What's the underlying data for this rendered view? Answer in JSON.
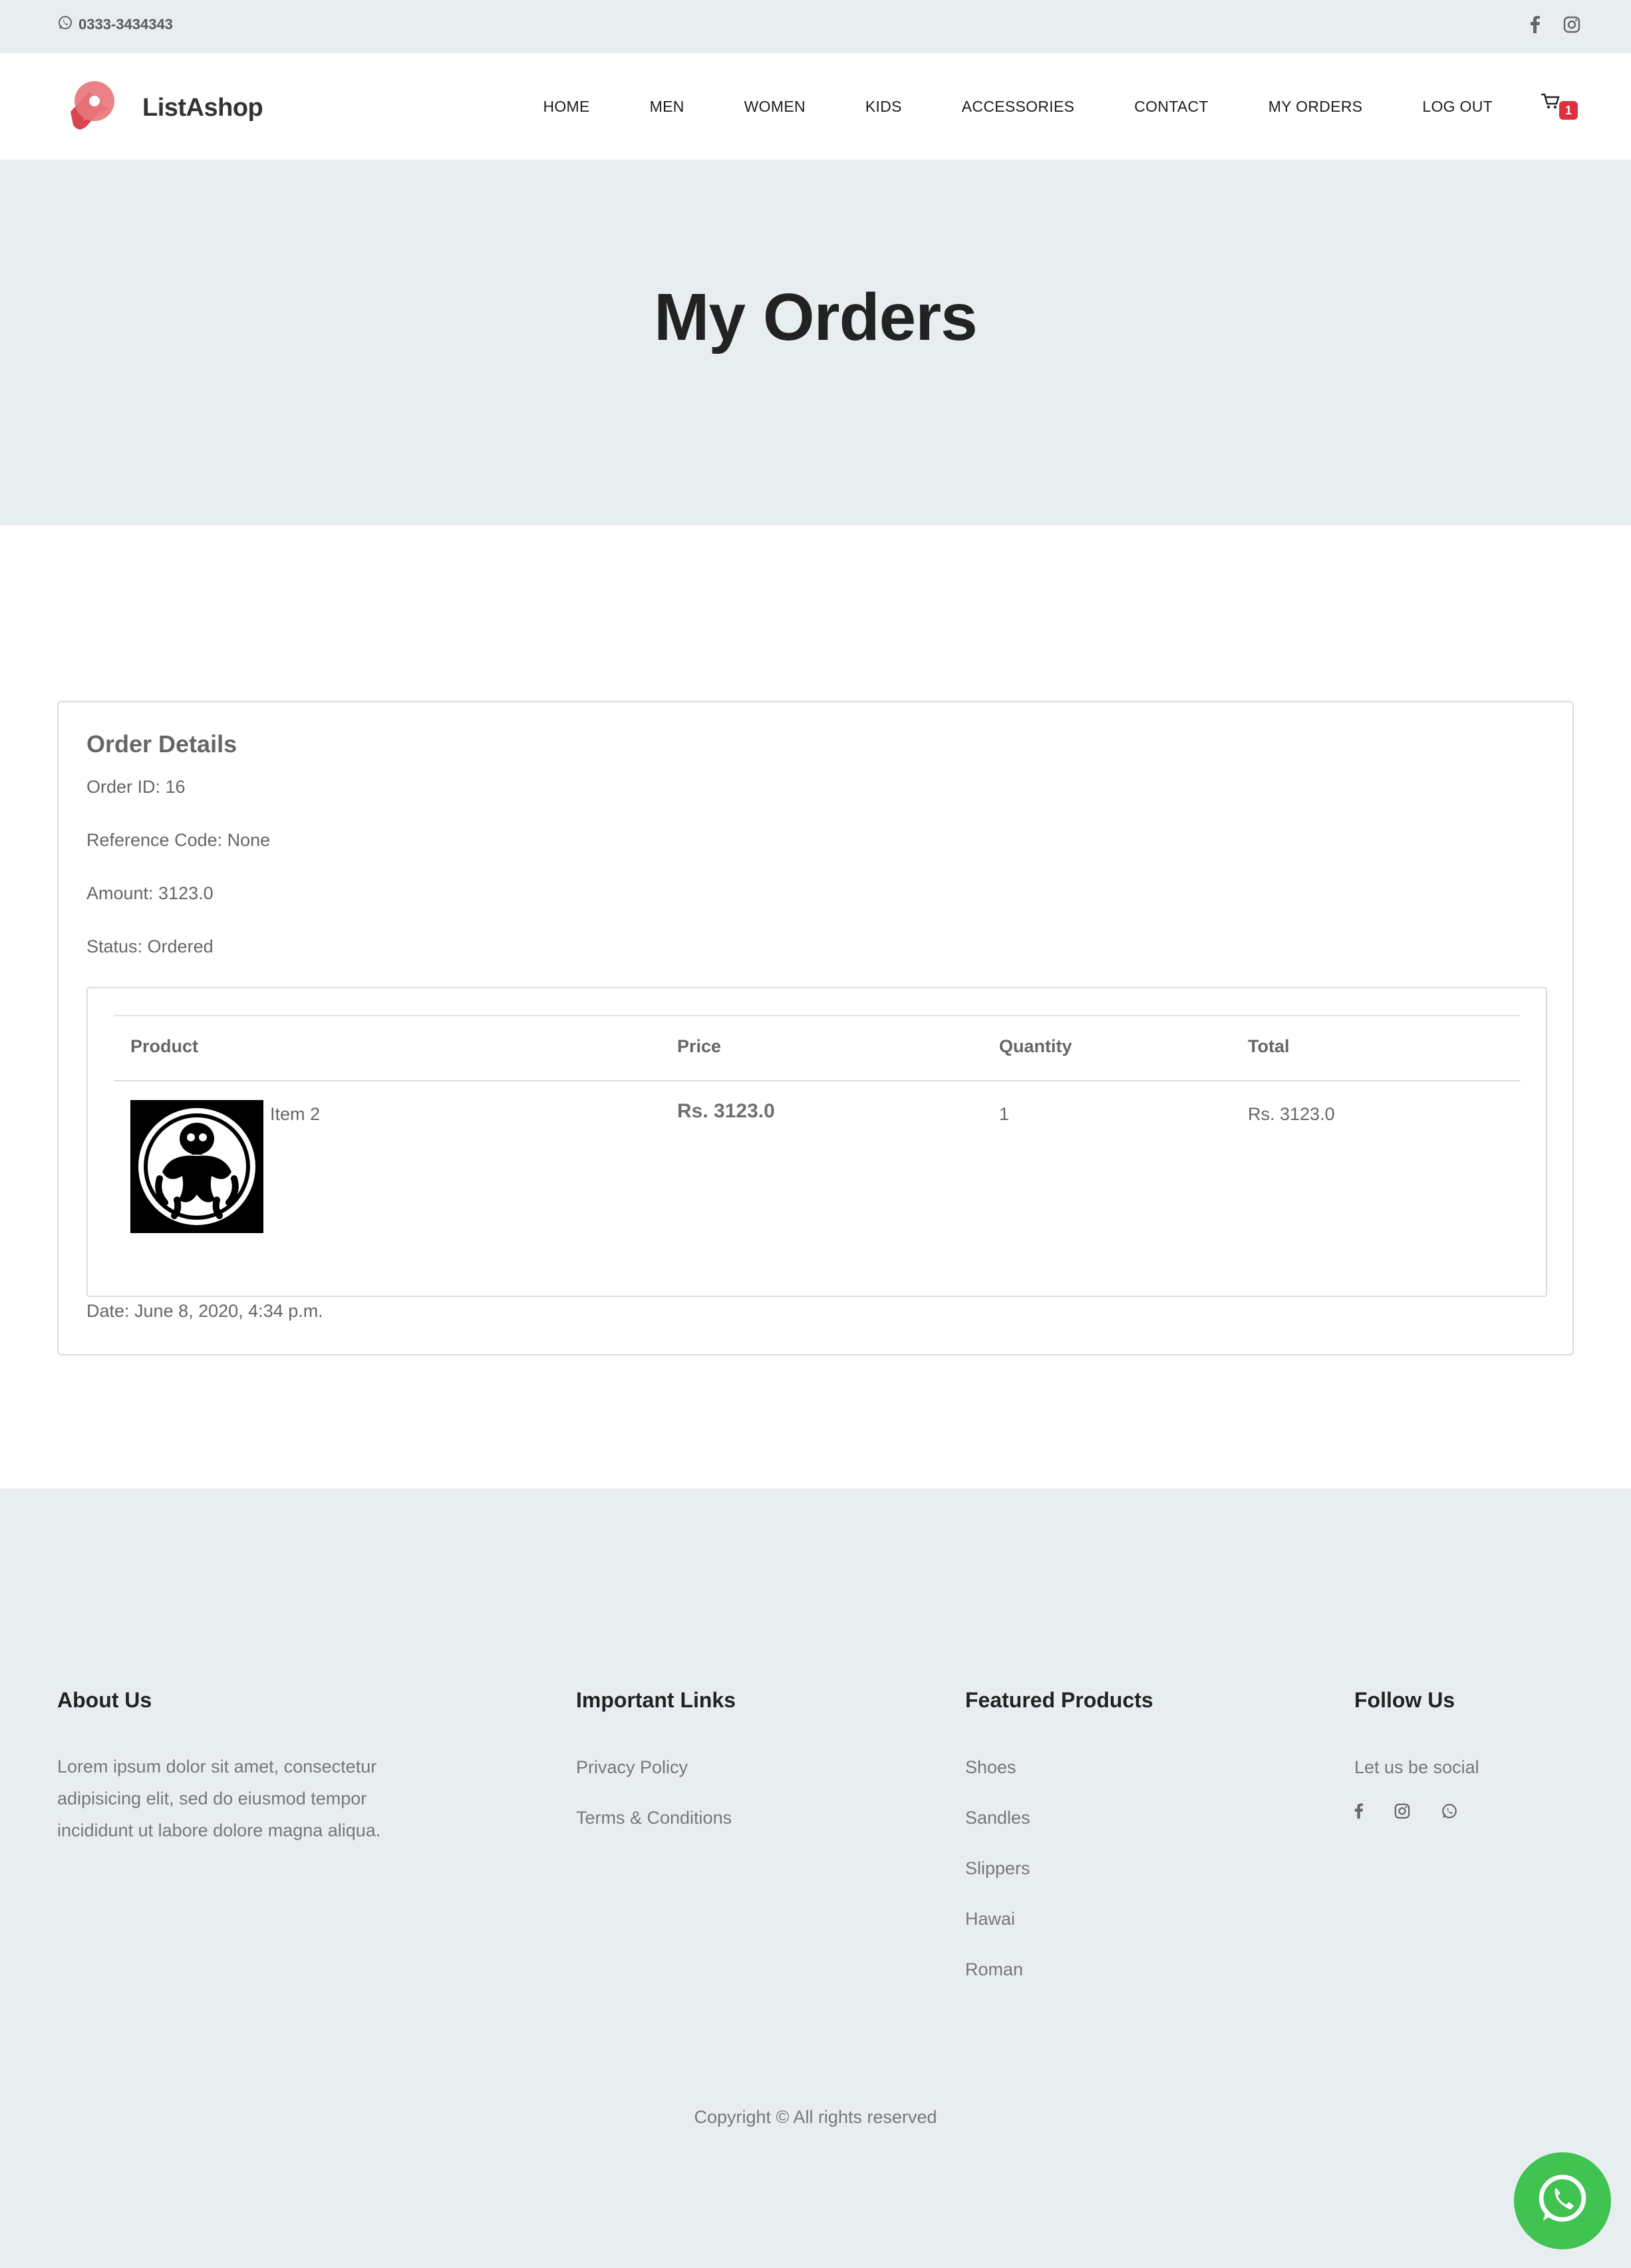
{
  "topbar": {
    "phone": "0333-3434343"
  },
  "header": {
    "brand": "ListAshop",
    "nav": [
      {
        "label": "HOME"
      },
      {
        "label": "MEN"
      },
      {
        "label": "WOMEN"
      },
      {
        "label": "KIDS"
      },
      {
        "label": "ACCESSORIES"
      },
      {
        "label": "CONTACT"
      },
      {
        "label": "MY ORDERS"
      },
      {
        "label": "LOG OUT"
      }
    ],
    "cart_count": "1"
  },
  "hero": {
    "title": "My Orders"
  },
  "order": {
    "title": "Order Details",
    "order_id": "Order ID: 16",
    "reference": "Reference Code: None",
    "amount": "Amount: 3123.0",
    "status": "Status: Ordered",
    "table": {
      "headers": [
        "Product",
        "Price",
        "Quantity",
        "Total"
      ],
      "rows": [
        {
          "product": "Item 2",
          "price": "Rs. 3123.0",
          "quantity": "1",
          "total": "Rs. 3123.0"
        }
      ]
    },
    "date": "Date: June 8, 2020, 4:34 p.m."
  },
  "footer": {
    "about": {
      "title": "About Us",
      "text": "Lorem ipsum dolor sit amet, consectetur adipisicing elit, sed do eiusmod tempor incididunt ut labore dolore magna aliqua."
    },
    "links": {
      "title": "Important Links",
      "items": [
        "Privacy Policy",
        "Terms & Conditions"
      ]
    },
    "featured": {
      "title": "Featured Products",
      "items": [
        "Shoes",
        "Sandles",
        "Slippers",
        "Hawai",
        "Roman"
      ]
    },
    "follow": {
      "title": "Follow Us",
      "text": "Let us be social"
    },
    "copyright": "Copyright © All rights reserved"
  },
  "colors": {
    "accent": "#e0303d",
    "whatsapp": "#40c351",
    "band": "#e8eef0"
  },
  "icons": [
    "whatsapp-icon",
    "facebook-icon",
    "instagram-icon",
    "cart-icon",
    "logo-icon"
  ]
}
